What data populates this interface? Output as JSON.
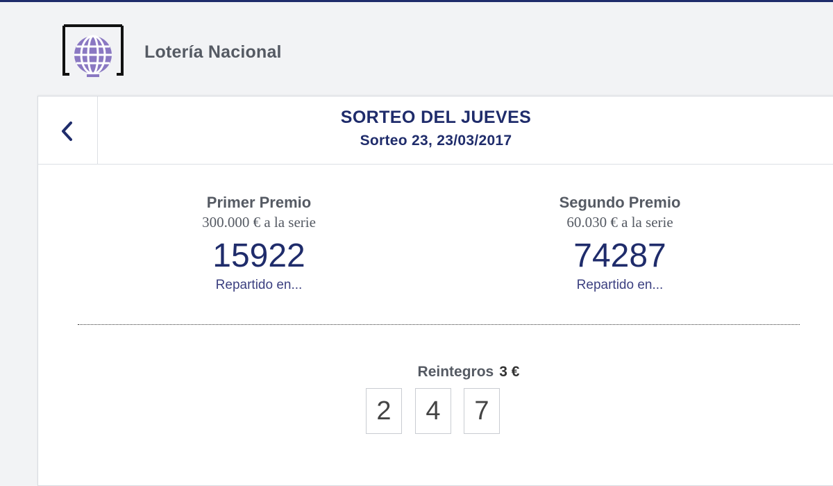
{
  "app": {
    "title": "Lotería Nacional",
    "logo_icon": "globe-logo-icon"
  },
  "draw": {
    "title": "SORTEO DEL JUEVES",
    "subtitle": "Sorteo 23, 23/03/2017"
  },
  "prizes": [
    {
      "name": "Primer Premio",
      "amount": "300.000 € a la serie",
      "number": "15922",
      "link": "Repartido en..."
    },
    {
      "name": "Segundo Premio",
      "amount": "60.030 € a la serie",
      "number": "74287",
      "link": "Repartido en..."
    }
  ],
  "refunds": {
    "label": "Reintegros",
    "value": "3 €",
    "numbers": [
      "2",
      "4",
      "7"
    ]
  },
  "colors": {
    "brand_navy": "#1f2c6b",
    "logo_purple": "#7e6bb5",
    "text_gray": "#555a63"
  }
}
